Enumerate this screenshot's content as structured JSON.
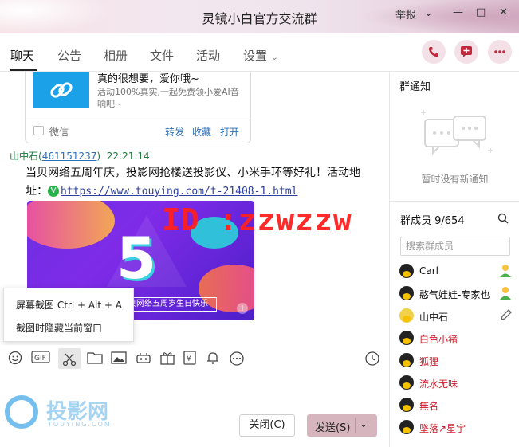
{
  "window": {
    "title": "灵镜小白官方交流群",
    "report_label": "举报",
    "controls": [
      "⌄",
      "—",
      "□",
      "✕"
    ]
  },
  "tabs": [
    {
      "label": "聊天",
      "active": true
    },
    {
      "label": "公告"
    },
    {
      "label": "相册"
    },
    {
      "label": "文件"
    },
    {
      "label": "活动"
    },
    {
      "label": "设置"
    }
  ],
  "colors": {
    "accent": "#c0283c",
    "link": "#2c6fb7",
    "send_button": "#d7b5bf",
    "watermark": "#ff2020"
  },
  "chat": {
    "share_card": {
      "title": "真的很想要，爱你哦~",
      "desc": "活动100%真实,一起免费领小爱AI音响吧~",
      "source": "微信",
      "actions": [
        "转发",
        "收藏",
        "打开"
      ]
    },
    "message": {
      "sender": "山中石",
      "qq_open": "(",
      "qq": "461151237",
      "qq_close": ")",
      "time": "22:21:14",
      "text": "当贝网络五周年庆，投影网抢楼送投影仪、小米手环等好礼！活动地址：",
      "link": "https://www.touying.com/t-21408-1.html",
      "image_ribbon": "贝网络五周岁生日快乐"
    },
    "watermark": "ID :zzwzzw"
  },
  "screenshot_menu": {
    "items": [
      "屏幕截图 Ctrl + Alt + A",
      "截图时隐藏当前窗口"
    ]
  },
  "toolbar": {
    "icons": [
      "smile-icon",
      "gif-icon",
      "scissors-icon",
      "folder-icon",
      "image-icon",
      "game-icon",
      "gift-icon",
      "red-packet-icon",
      "bell-icon",
      "more-icon",
      "history-icon"
    ]
  },
  "input": {
    "logo_text": "投影网",
    "logo_sub": "TOUYING.COM",
    "close_label": "关闭(C)",
    "send_label": "发送(S)"
  },
  "right_panel": {
    "notice_title": "群通知",
    "notice_empty": "暂时没有新通知",
    "members_title": "群成员 9/654",
    "search_placeholder": "搜索群成员",
    "members": [
      {
        "name": "Carl",
        "color": "#111",
        "badge": "admin"
      },
      {
        "name": "憨气娃娃-专家也",
        "color": "#111",
        "badge": "admin"
      },
      {
        "name": "山中石",
        "color": "#111",
        "badge": "edit"
      },
      {
        "name": "白色小猪",
        "color": "#d0182a"
      },
      {
        "name": "狐狸",
        "color": "#d0182a"
      },
      {
        "name": "流水无味",
        "color": "#d0182a"
      },
      {
        "name": "無名",
        "color": "#d0182a"
      },
      {
        "name": "墜落↗星宇",
        "color": "#d0182a"
      }
    ]
  }
}
